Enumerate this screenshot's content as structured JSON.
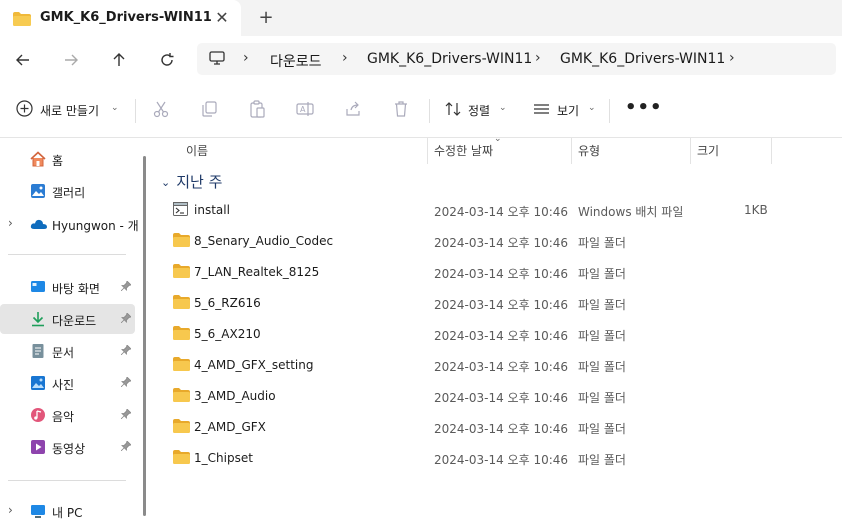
{
  "tab": {
    "title": "GMK_K6_Drivers-WIN11",
    "close": "✕",
    "new_tab": "+"
  },
  "breadcrumb": [
    "다운로드",
    "GMK_K6_Drivers-WIN11",
    "GMK_K6_Drivers-WIN11"
  ],
  "breadcrumb_sep": "›",
  "toolbar": {
    "new_label": "새로 만들기",
    "sort_label": "정렬",
    "view_label": "보기",
    "more_label": "•••",
    "dropdown_chevron": "⌄"
  },
  "sidebar": {
    "items": [
      {
        "label": "홈",
        "icon": "home-icon"
      },
      {
        "label": "갤러리",
        "icon": "gallery-icon"
      },
      {
        "label": "Hyungwon - 개",
        "icon": "onedrive-icon",
        "expander": "›"
      },
      {
        "label": "바탕 화면",
        "icon": "desktop-icon",
        "pinned": true
      },
      {
        "label": "다운로드",
        "icon": "downloads-icon",
        "pinned": true,
        "active": true
      },
      {
        "label": "문서",
        "icon": "documents-icon",
        "pinned": true
      },
      {
        "label": "사진",
        "icon": "pictures-icon",
        "pinned": true
      },
      {
        "label": "음악",
        "icon": "music-icon",
        "pinned": true
      },
      {
        "label": "동영상",
        "icon": "videos-icon",
        "pinned": true
      },
      {
        "label": "내 PC",
        "icon": "this-pc-icon",
        "expander": "›"
      }
    ]
  },
  "columns": {
    "name": "이름",
    "modified": "수정한 날짜",
    "type": "유형",
    "size": "크기"
  },
  "group": {
    "label": "지난 주",
    "chevron": "⌄"
  },
  "files": [
    {
      "name": "install",
      "date": "2024-03-14 오후 10:46",
      "type": "Windows 배치 파일",
      "size": "1KB",
      "icon": "batch-file-icon"
    },
    {
      "name": "8_Senary_Audio_Codec",
      "date": "2024-03-14 오후 10:46",
      "type": "파일 폴더",
      "size": "",
      "icon": "folder-icon"
    },
    {
      "name": "7_LAN_Realtek_8125",
      "date": "2024-03-14 오후 10:46",
      "type": "파일 폴더",
      "size": "",
      "icon": "folder-icon"
    },
    {
      "name": "5_6_RZ616",
      "date": "2024-03-14 오후 10:46",
      "type": "파일 폴더",
      "size": "",
      "icon": "folder-icon"
    },
    {
      "name": "5_6_AX210",
      "date": "2024-03-14 오후 10:46",
      "type": "파일 폴더",
      "size": "",
      "icon": "folder-icon"
    },
    {
      "name": "4_AMD_GFX_setting",
      "date": "2024-03-14 오후 10:46",
      "type": "파일 폴더",
      "size": "",
      "icon": "folder-icon"
    },
    {
      "name": "3_AMD_Audio",
      "date": "2024-03-14 오후 10:46",
      "type": "파일 폴더",
      "size": "",
      "icon": "folder-icon"
    },
    {
      "name": "2_AMD_GFX",
      "date": "2024-03-14 오후 10:46",
      "type": "파일 폴더",
      "size": "",
      "icon": "folder-icon"
    },
    {
      "name": "1_Chipset",
      "date": "2024-03-14 오후 10:46",
      "type": "파일 폴더",
      "size": "",
      "icon": "folder-icon"
    }
  ],
  "colors": {
    "folder": "#f5c04a",
    "accent": "#0067c0",
    "active_bg": "#e5e5e5"
  }
}
